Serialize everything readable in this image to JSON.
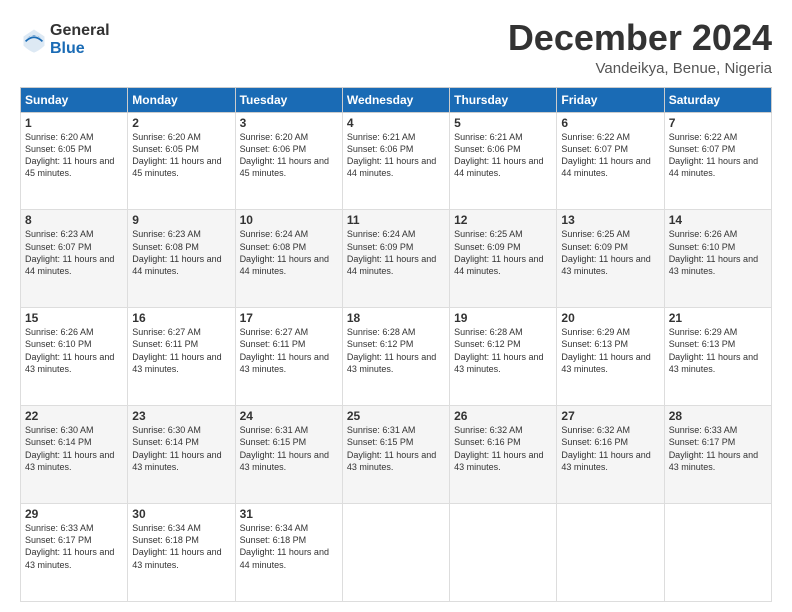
{
  "logo": {
    "general": "General",
    "blue": "Blue"
  },
  "header": {
    "month": "December 2024",
    "location": "Vandeikya, Benue, Nigeria"
  },
  "weekdays": [
    "Sunday",
    "Monday",
    "Tuesday",
    "Wednesday",
    "Thursday",
    "Friday",
    "Saturday"
  ],
  "weeks": [
    [
      {
        "day": "1",
        "sunrise": "6:20 AM",
        "sunset": "6:05 PM",
        "daylight": "11 hours and 45 minutes."
      },
      {
        "day": "2",
        "sunrise": "6:20 AM",
        "sunset": "6:05 PM",
        "daylight": "11 hours and 45 minutes."
      },
      {
        "day": "3",
        "sunrise": "6:20 AM",
        "sunset": "6:06 PM",
        "daylight": "11 hours and 45 minutes."
      },
      {
        "day": "4",
        "sunrise": "6:21 AM",
        "sunset": "6:06 PM",
        "daylight": "11 hours and 44 minutes."
      },
      {
        "day": "5",
        "sunrise": "6:21 AM",
        "sunset": "6:06 PM",
        "daylight": "11 hours and 44 minutes."
      },
      {
        "day": "6",
        "sunrise": "6:22 AM",
        "sunset": "6:07 PM",
        "daylight": "11 hours and 44 minutes."
      },
      {
        "day": "7",
        "sunrise": "6:22 AM",
        "sunset": "6:07 PM",
        "daylight": "11 hours and 44 minutes."
      }
    ],
    [
      {
        "day": "8",
        "sunrise": "6:23 AM",
        "sunset": "6:07 PM",
        "daylight": "11 hours and 44 minutes."
      },
      {
        "day": "9",
        "sunrise": "6:23 AM",
        "sunset": "6:08 PM",
        "daylight": "11 hours and 44 minutes."
      },
      {
        "day": "10",
        "sunrise": "6:24 AM",
        "sunset": "6:08 PM",
        "daylight": "11 hours and 44 minutes."
      },
      {
        "day": "11",
        "sunrise": "6:24 AM",
        "sunset": "6:09 PM",
        "daylight": "11 hours and 44 minutes."
      },
      {
        "day": "12",
        "sunrise": "6:25 AM",
        "sunset": "6:09 PM",
        "daylight": "11 hours and 44 minutes."
      },
      {
        "day": "13",
        "sunrise": "6:25 AM",
        "sunset": "6:09 PM",
        "daylight": "11 hours and 43 minutes."
      },
      {
        "day": "14",
        "sunrise": "6:26 AM",
        "sunset": "6:10 PM",
        "daylight": "11 hours and 43 minutes."
      }
    ],
    [
      {
        "day": "15",
        "sunrise": "6:26 AM",
        "sunset": "6:10 PM",
        "daylight": "11 hours and 43 minutes."
      },
      {
        "day": "16",
        "sunrise": "6:27 AM",
        "sunset": "6:11 PM",
        "daylight": "11 hours and 43 minutes."
      },
      {
        "day": "17",
        "sunrise": "6:27 AM",
        "sunset": "6:11 PM",
        "daylight": "11 hours and 43 minutes."
      },
      {
        "day": "18",
        "sunrise": "6:28 AM",
        "sunset": "6:12 PM",
        "daylight": "11 hours and 43 minutes."
      },
      {
        "day": "19",
        "sunrise": "6:28 AM",
        "sunset": "6:12 PM",
        "daylight": "11 hours and 43 minutes."
      },
      {
        "day": "20",
        "sunrise": "6:29 AM",
        "sunset": "6:13 PM",
        "daylight": "11 hours and 43 minutes."
      },
      {
        "day": "21",
        "sunrise": "6:29 AM",
        "sunset": "6:13 PM",
        "daylight": "11 hours and 43 minutes."
      }
    ],
    [
      {
        "day": "22",
        "sunrise": "6:30 AM",
        "sunset": "6:14 PM",
        "daylight": "11 hours and 43 minutes."
      },
      {
        "day": "23",
        "sunrise": "6:30 AM",
        "sunset": "6:14 PM",
        "daylight": "11 hours and 43 minutes."
      },
      {
        "day": "24",
        "sunrise": "6:31 AM",
        "sunset": "6:15 PM",
        "daylight": "11 hours and 43 minutes."
      },
      {
        "day": "25",
        "sunrise": "6:31 AM",
        "sunset": "6:15 PM",
        "daylight": "11 hours and 43 minutes."
      },
      {
        "day": "26",
        "sunrise": "6:32 AM",
        "sunset": "6:16 PM",
        "daylight": "11 hours and 43 minutes."
      },
      {
        "day": "27",
        "sunrise": "6:32 AM",
        "sunset": "6:16 PM",
        "daylight": "11 hours and 43 minutes."
      },
      {
        "day": "28",
        "sunrise": "6:33 AM",
        "sunset": "6:17 PM",
        "daylight": "11 hours and 43 minutes."
      }
    ],
    [
      {
        "day": "29",
        "sunrise": "6:33 AM",
        "sunset": "6:17 PM",
        "daylight": "11 hours and 43 minutes."
      },
      {
        "day": "30",
        "sunrise": "6:34 AM",
        "sunset": "6:18 PM",
        "daylight": "11 hours and 43 minutes."
      },
      {
        "day": "31",
        "sunrise": "6:34 AM",
        "sunset": "6:18 PM",
        "daylight": "11 hours and 44 minutes."
      },
      null,
      null,
      null,
      null
    ]
  ]
}
